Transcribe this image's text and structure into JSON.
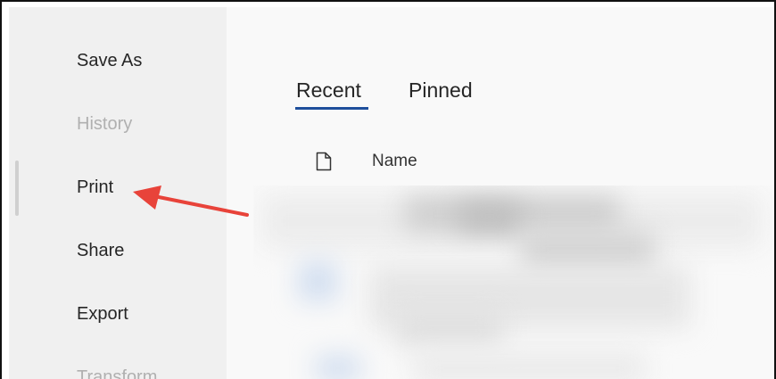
{
  "sidebar": {
    "items": [
      {
        "label": "Save As",
        "enabled": true
      },
      {
        "label": "History",
        "enabled": false
      },
      {
        "label": "Print",
        "enabled": true
      },
      {
        "label": "Share",
        "enabled": true
      },
      {
        "label": "Export",
        "enabled": true
      },
      {
        "label": "Transform",
        "enabled": false
      }
    ]
  },
  "main": {
    "tabs": [
      {
        "label": "Recent",
        "selected": true
      },
      {
        "label": "Pinned",
        "selected": false
      }
    ],
    "file_list": {
      "columns": [
        {
          "label": "Name"
        }
      ]
    }
  },
  "colors": {
    "accent": "#1e4f9c",
    "annotation_arrow": "#e8433a",
    "sidebar_bg": "#f0f0f0",
    "main_bg": "#f9f9f9"
  },
  "icons": {
    "file_column_icon": "document-icon",
    "annotation": "arrow-annotation-icon"
  }
}
